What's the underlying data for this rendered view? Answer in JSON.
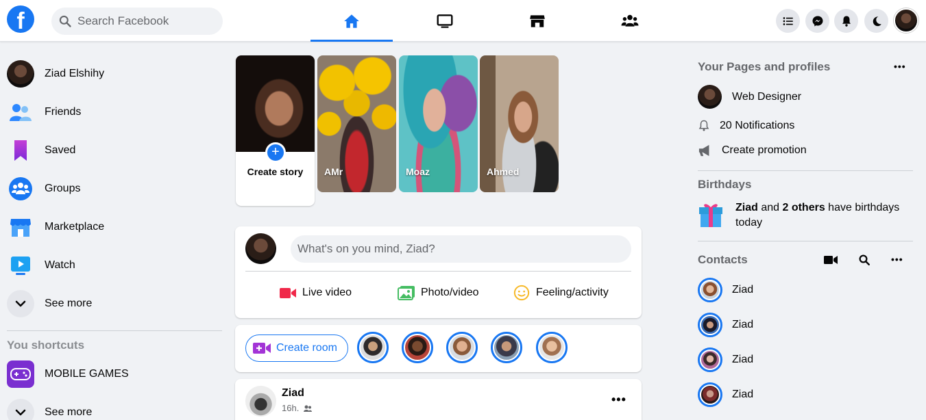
{
  "header": {
    "logo": "f",
    "search_placeholder": "Search Facebook",
    "nav_tabs": [
      "home-icon",
      "watch-icon",
      "marketplace-icon",
      "groups-icon"
    ],
    "right_buttons": [
      "menu-icon",
      "messenger-icon",
      "bell-icon",
      "moon-icon",
      "profile-avatar"
    ],
    "accent": "#1877f2"
  },
  "sidebar": {
    "items": [
      {
        "label": "Ziad Elshihy",
        "icon": "profile-avatar"
      },
      {
        "label": "Friends",
        "icon": "friends-icon"
      },
      {
        "label": "Saved",
        "icon": "saved-icon"
      },
      {
        "label": "Groups",
        "icon": "groups-icon"
      },
      {
        "label": "Marketplace",
        "icon": "marketplace-icon"
      },
      {
        "label": "Watch",
        "icon": "watch-icon"
      },
      {
        "label": "See more",
        "icon": "chevron-down-icon"
      }
    ],
    "shortcuts_title": "You shortcuts",
    "shortcuts": [
      {
        "label": "MOBILE GAMES",
        "icon": "game-icon"
      },
      {
        "label": "See more",
        "icon": "chevron-down-icon"
      }
    ]
  },
  "stories": {
    "create_label": "Create story",
    "items": [
      {
        "name": "AMr"
      },
      {
        "name": "Moaz"
      },
      {
        "name": "Ahmed"
      }
    ]
  },
  "composer": {
    "placeholder": "What's on you mind, Ziad?",
    "actions": [
      {
        "label": "Live video",
        "icon": "live-video-icon",
        "color": "#f02849"
      },
      {
        "label": "Photo/video",
        "icon": "photo-icon",
        "color": "#45bd62"
      },
      {
        "label": "Feeling/activity",
        "icon": "smile-icon",
        "color": "#f7b928"
      }
    ]
  },
  "rooms": {
    "create_label": "Create room"
  },
  "post": {
    "author": "Ziad",
    "time": "16h."
  },
  "right": {
    "pages_title": "Your Pages and profiles",
    "page_name": "Web Designer",
    "notifications": "20 Notifications",
    "promotion": "Create promotion",
    "birthdays_title": "Birthdays",
    "birthday_name": "Ziad",
    "birthday_and": " and ",
    "birthday_others": "2 others",
    "birthday_rest": " have birthdays",
    "birthday_today": "today",
    "contacts_title": "Contacts",
    "contacts": [
      "Ziad",
      "Ziad",
      "Ziad",
      "Ziad"
    ]
  }
}
